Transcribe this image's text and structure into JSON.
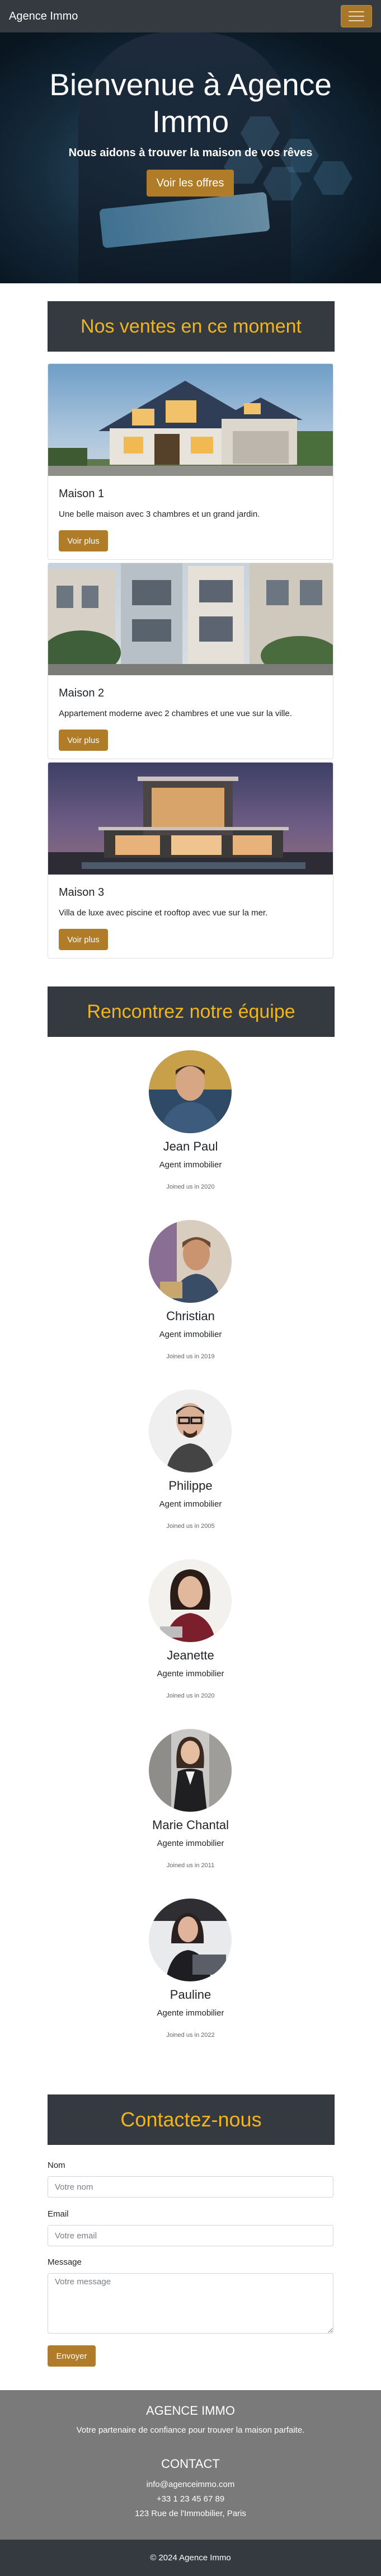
{
  "navbar": {
    "brand": "Agence Immo"
  },
  "hero": {
    "title": "Bienvenue à Agence Immo",
    "subtitle": "Nous aidons à trouver la maison de vos rêves",
    "cta": "Voir les offres"
  },
  "sales": {
    "heading": "Nos ventes en ce moment",
    "cards": [
      {
        "title": "Maison 1",
        "description": "Une belle maison avec 3 chambres et un grand jardin.",
        "button": "Voir plus"
      },
      {
        "title": "Maison 2",
        "description": "Appartement moderne avec 2 chambres et une vue sur la ville.",
        "button": "Voir plus"
      },
      {
        "title": "Maison 3",
        "description": "Villa de luxe avec piscine et rooftop avec vue sur la mer.",
        "button": "Voir plus"
      }
    ]
  },
  "team": {
    "heading": "Rencontrez notre équipe",
    "members": [
      {
        "name": "Jean Paul",
        "role": "Agent immobilier",
        "joined": "Joined us in 2020"
      },
      {
        "name": "Christian",
        "role": "Agent immobilier",
        "joined": "Joined us in 2019"
      },
      {
        "name": "Philippe",
        "role": "Agent immobilier",
        "joined": "Joined us in 2005"
      },
      {
        "name": "Jeanette",
        "role": "Agente immobilier",
        "joined": "Joined us in 2020"
      },
      {
        "name": "Marie Chantal",
        "role": "Agente immobilier",
        "joined": "Joined us in 2011"
      },
      {
        "name": "Pauline",
        "role": "Agente immobilier",
        "joined": "Joined us in 2022"
      }
    ]
  },
  "contact": {
    "heading": "Contactez-nous",
    "name_label": "Nom",
    "name_placeholder": "Votre nom",
    "email_label": "Email",
    "email_placeholder": "Votre email",
    "message_label": "Message",
    "message_placeholder": "Votre message",
    "submit": "Envoyer"
  },
  "footer": {
    "brand_heading": "AGENCE IMMO",
    "tagline": "Votre partenaire de confiance pour trouver la maison parfaite.",
    "contact_heading": "CONTACT",
    "email": "info@agenceimmo.com",
    "phone": "+33 1 23 45 67 89",
    "address": "123 Rue de l'Immobilier, Paris",
    "copyright": "© 2024 Agence Immo"
  },
  "colors": {
    "navbar": "#343a40",
    "accent_gold": "#b07c27",
    "heading_yellow": "#f0b51c",
    "footer_gray": "#7a7a7a"
  },
  "icons": {
    "menu": "hamburger-menu-icon"
  }
}
